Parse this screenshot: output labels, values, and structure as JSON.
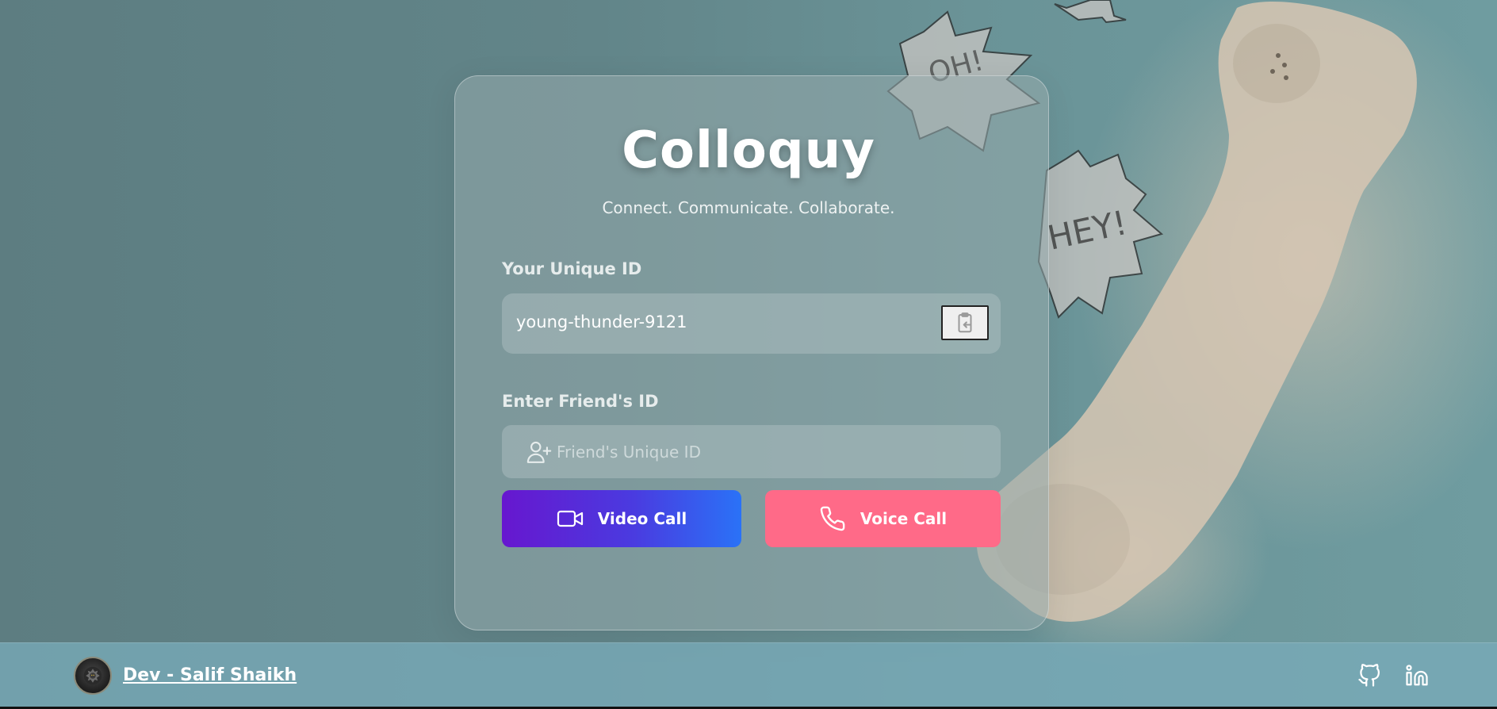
{
  "app": {
    "title": "Colloquy",
    "tagline": "Connect. Communicate. Collaborate."
  },
  "unique_id": {
    "label": "Your Unique ID",
    "value": "young-thunder-9121",
    "copy_icon": "clipboard-copy-icon"
  },
  "friend_id": {
    "label": "Enter Friend's ID",
    "placeholder": "Friend's Unique ID",
    "value": "",
    "icon": "user-plus-icon"
  },
  "buttons": {
    "video_call": "Video Call",
    "voice_call": "Voice Call"
  },
  "footer": {
    "developer_link": "Dev - Salif Shaikh",
    "social_icons": [
      "github-icon",
      "linkedin-icon"
    ]
  },
  "colors": {
    "video_gradient_start": "#6717cf",
    "video_gradient_end": "#2a72f7",
    "voice_button": "#ff6a88",
    "background": "#5f8185",
    "footer": "#78aab9"
  }
}
